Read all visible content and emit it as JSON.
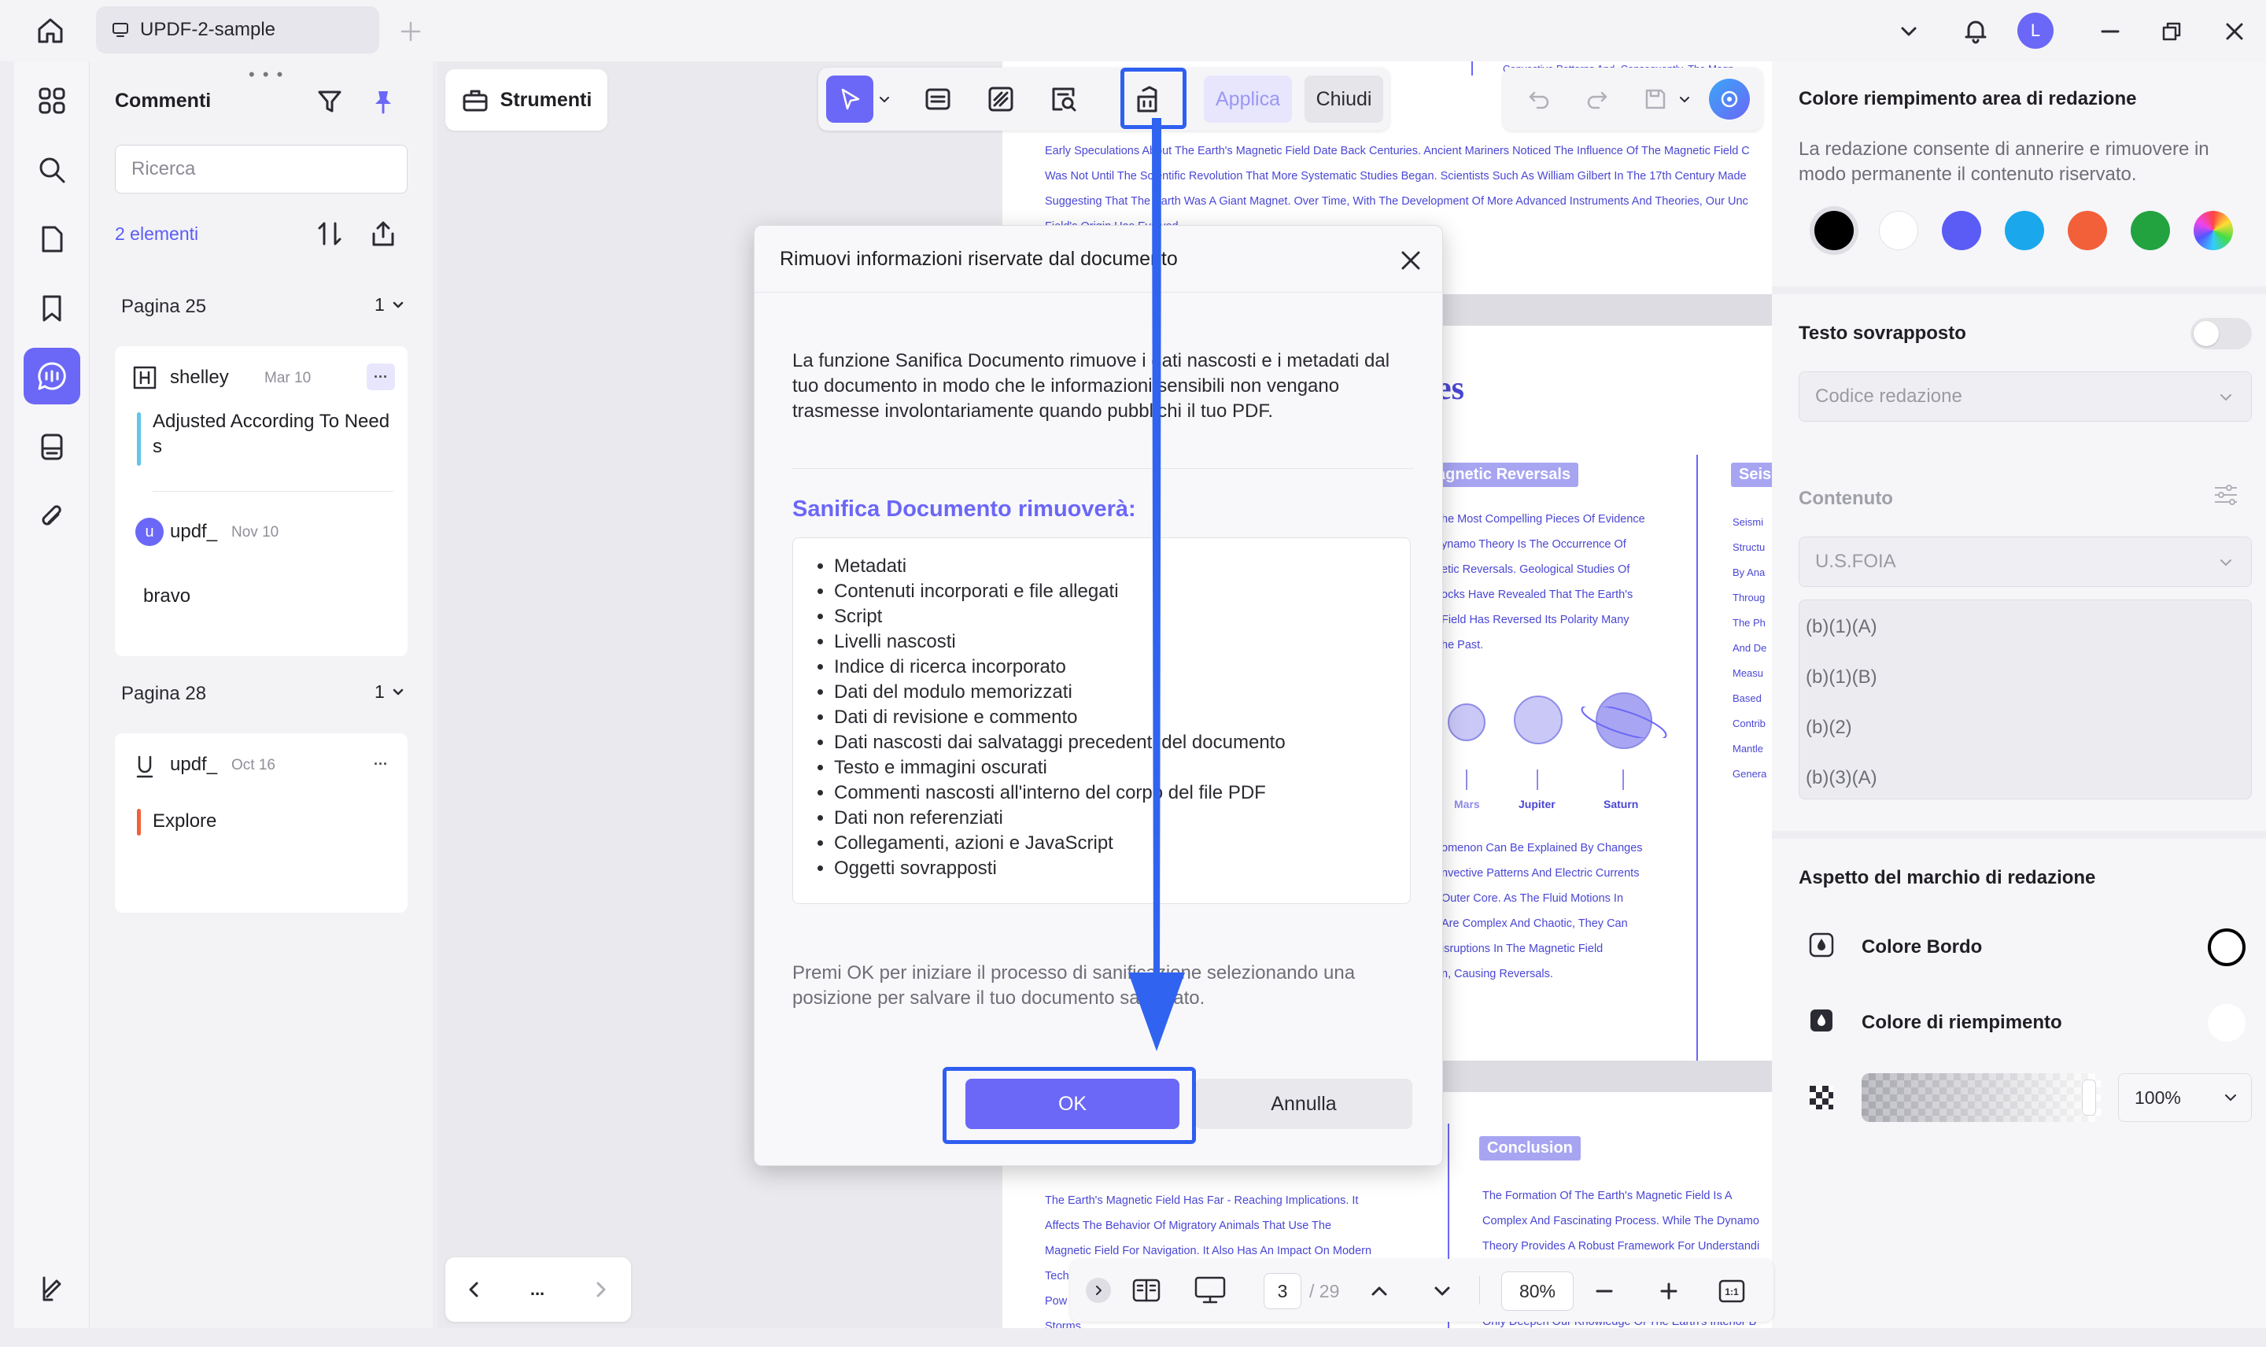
{
  "titlebar": {
    "doc_tab": "UPDF-2-sample",
    "avatar_letter": "L"
  },
  "comments": {
    "title": "Commenti",
    "search_placeholder": "Ricerca",
    "count": "2 elementi",
    "groups": [
      {
        "page": "Pagina 25",
        "count": "1",
        "comment": {
          "author": "shelley",
          "date": "Mar 10",
          "text": "Adjusted According To Need s"
        },
        "reply": {
          "author": "updf_",
          "avatar": "u",
          "date": "Nov 10",
          "text": "bravo"
        }
      },
      {
        "page": "Pagina 28",
        "count": "1",
        "comment": {
          "author": "updf_",
          "date": "Oct 16",
          "text": "Explore"
        }
      }
    ]
  },
  "tools": {
    "strumenti_label": "Strumenti",
    "apply_label": "Applica",
    "close_label": "Chiudi"
  },
  "document": {
    "top_line": "Convective Patterns And, Consequently, The Magn",
    "intro_lines": [
      "Early Speculations About The Earth's Magnetic Field Date Back Centuries. Ancient Mariners Noticed The Influence Of The Magnetic Field C",
      "Was Not Until The Scientific Revolution That More Systematic Studies Began. Scientists Such As William Gilbert In The 17th Century Made",
      "Suggesting That The Earth Was A Giant Magnet. Over Time, With The Development Of More Advanced Instruments And Theories, Our Unc",
      "Field's Origin Has Evolved."
    ],
    "heading_fragment": "es",
    "reversals_pill": "agnetic Reversals",
    "reversals_lines": [
      "he Most Compelling Pieces Of Evidence",
      "ynamo Theory Is The Occurrence Of",
      "etic Reversals. Geological Studies Of",
      "ocks Have Revealed That The Earth's",
      "Field Has Reversed Its Polarity Many",
      "he Past."
    ],
    "seis_pill": "Seis",
    "seis_lines": [
      "Seismi",
      "Structu",
      "By Ana",
      "Throug",
      "The Ph",
      "And De",
      "Measu",
      "Based",
      "Contrib",
      "Mantle",
      "Genera"
    ],
    "planets": [
      "Mars",
      "Jupiter",
      "Saturn"
    ],
    "lower_lines": [
      "omenon Can Be Explained By Changes",
      "nvective Patterns And Electric Currents",
      "Outer Core. As The Fluid Motions In",
      "Are Complex And Chaotic, They Can",
      "isruptions In The Magnetic Field",
      "n, Causing Reversals."
    ],
    "conclusion_pill": "Conclusion",
    "bottom_left_lines": [
      "The Earth's Magnetic Field Has Far - Reaching Implications. It",
      "Affects The Behavior Of Migratory Animals That Use The",
      "Magnetic Field For Navigation. It Also Has An Impact On Modern",
      "Tech",
      "Pow",
      "Storms"
    ],
    "bottom_right_lines": [
      "The Formation Of The Earth's Magnetic Field Is A",
      "Complex And Fascinating Process. While The Dynamo",
      "Theory Provides A Robust Framework For Understandi",
      "",
      "",
      "Only Deepen Our Knowledge Of The Earth's Interior B"
    ]
  },
  "dialog": {
    "title": "Rimuovi informazioni riservate dal documento",
    "description": "La funzione Sanifica Documento rimuove i dati nascosti e i metadati dal tuo documento in modo che le informazioni sensibili non vengano trasmesse involontariamente quando pubblichi il tuo PDF.",
    "subtitle": "Sanifica Documento rimuoverà:",
    "items": [
      "Metadati",
      "Contenuti incorporati e file allegati",
      "Script",
      "Livelli nascosti",
      "Indice di ricerca incorporato",
      "Dati del modulo memorizzati",
      "Dati di revisione e commento",
      "Dati nascosti dai salvataggi precedenti del documento",
      "Testo e immagini oscurati",
      "Commenti nascosti all'interno del corpo del file PDF",
      "Dati non referenziati",
      "Collegamenti, azioni e JavaScript",
      "Oggetti sovrapposti"
    ],
    "footer": "Premi OK per iniziare il processo di sanificazione selezionando una posizione per salvare il tuo documento sanificato.",
    "ok_label": "OK",
    "cancel_label": "Annulla"
  },
  "right_panel": {
    "fill_title": "Colore riempimento area di redazione",
    "fill_desc": "La redazione consente di annerire e rimuovere in modo permanente il contenuto riservato.",
    "swatches": [
      "#000000",
      "#ffffff",
      "#5b5cf6",
      "#1aa7ec",
      "#f2603a",
      "#22a340",
      "rainbow"
    ],
    "overlay_text_label": "Testo sovrapposto",
    "redaction_code_placeholder": "Codice redazione",
    "content_label": "Contenuto",
    "content_select": "U.S.FOIA",
    "content_items": [
      "(b)(1)(A)",
      "(b)(1)(B)",
      "(b)(2)",
      "(b)(3)(A)"
    ],
    "appearance_title": "Aspetto del marchio di redazione",
    "border_color_label": "Colore Bordo",
    "fill_color_label": "Colore di riempimento",
    "opacity_value": "100%"
  },
  "bottom_nav": {
    "current_page": "3",
    "total_pages": "/ 29",
    "zoom": "80%",
    "dots": "..."
  },
  "colors": {
    "accent": "#6b67f7",
    "highlight_box": "#2f5ef0",
    "arrow": "#2f63f0"
  }
}
